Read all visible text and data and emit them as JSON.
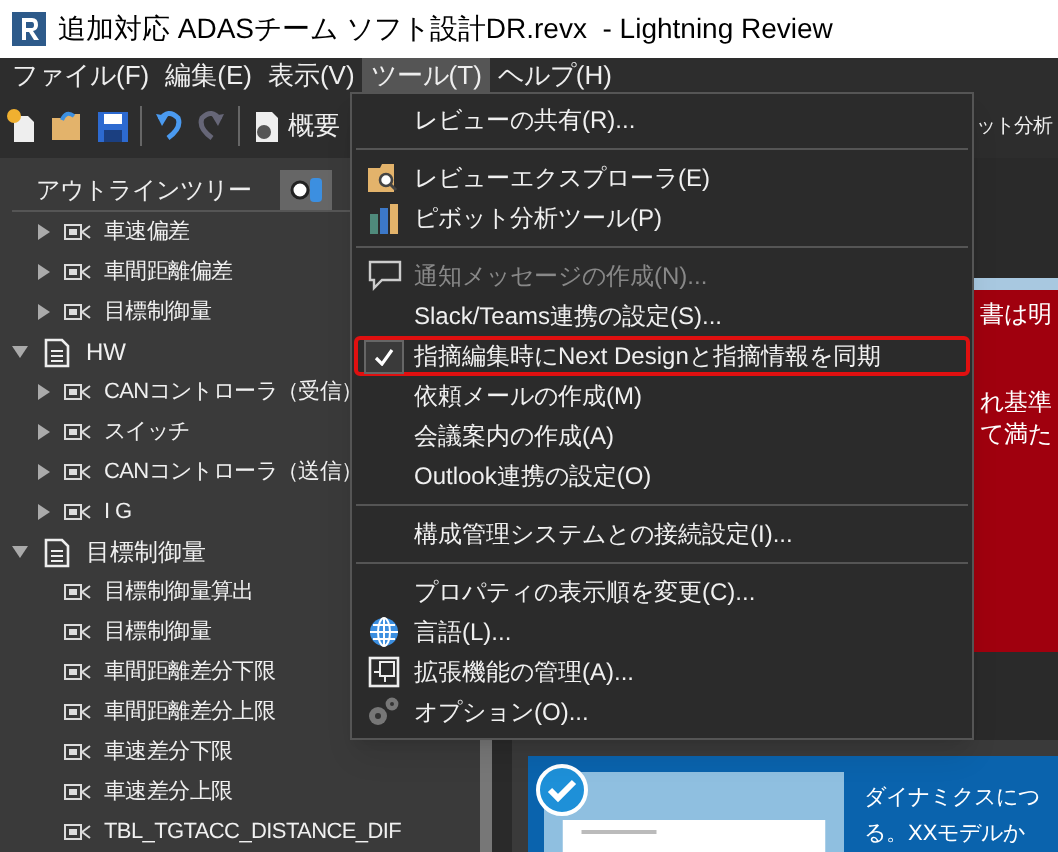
{
  "window": {
    "title": "追加対応 ADASチーム ソフト設計DR.revx  - Lightning Review"
  },
  "menu_bar": [
    {
      "label": "ファイル(F)",
      "selected": false
    },
    {
      "label": "編集(E)",
      "selected": false
    },
    {
      "label": "表示(V)",
      "selected": false
    },
    {
      "label": "ツール(T)",
      "selected": true
    },
    {
      "label": "ヘルプ(H)",
      "selected": false
    }
  ],
  "toolbar": {
    "overview": "概要",
    "right_label": "ット分析"
  },
  "outline": {
    "title": "アウトラインツリー",
    "partial_children": [
      {
        "label": "車速偏差",
        "expandable": true
      },
      {
        "label": "車間距離偏差",
        "expandable": true
      },
      {
        "label": "目標制御量",
        "expandable": true
      }
    ],
    "nodes": [
      {
        "label": "HW",
        "expanded": true,
        "children": [
          {
            "label": "CANコントローラ（受信）",
            "expandable": true
          },
          {
            "label": "スイッチ",
            "expandable": true
          },
          {
            "label": "CANコントローラ（送信）",
            "expandable": true
          },
          {
            "label": "I G",
            "expandable": true
          }
        ]
      },
      {
        "label": "目標制御量",
        "expanded": true,
        "children": [
          {
            "label": "目標制御量算出",
            "expandable": false
          },
          {
            "label": "目標制御量",
            "expandable": false
          },
          {
            "label": "車間距離差分下限",
            "expandable": false
          },
          {
            "label": "車間距離差分上限",
            "expandable": false
          },
          {
            "label": "車速差分下限",
            "expandable": false
          },
          {
            "label": "車速差分上限",
            "expandable": false
          },
          {
            "label": "TBL_TGTACC_DISTANCE_DIF",
            "expandable": false
          }
        ]
      }
    ]
  },
  "tools_menu": [
    {
      "kind": "plain",
      "label": "レビューの共有(R)...",
      "disabled": false,
      "checked": false,
      "highlighted": false
    },
    {
      "kind": "separator"
    },
    {
      "kind": "folder",
      "label": "レビューエクスプローラ(E)",
      "disabled": false,
      "checked": false,
      "highlighted": false
    },
    {
      "kind": "chart",
      "label": "ピボット分析ツール(P)",
      "disabled": false,
      "checked": false,
      "highlighted": false
    },
    {
      "kind": "separator"
    },
    {
      "kind": "comment",
      "label": "通知メッセージの作成(N)...",
      "disabled": true,
      "checked": false,
      "highlighted": false
    },
    {
      "kind": "plain",
      "label": "Slack/Teams連携の設定(S)...",
      "disabled": false,
      "checked": false,
      "highlighted": false
    },
    {
      "kind": "plain",
      "label": "指摘編集時にNext Designと指摘情報を同期",
      "disabled": false,
      "checked": true,
      "highlighted": true
    },
    {
      "kind": "plain",
      "label": "依頼メールの作成(M)",
      "disabled": false,
      "checked": false,
      "highlighted": false
    },
    {
      "kind": "plain",
      "label": "会議案内の作成(A)",
      "disabled": false,
      "checked": false,
      "highlighted": false
    },
    {
      "kind": "plain",
      "label": "Outlook連携の設定(O)",
      "disabled": false,
      "checked": false,
      "highlighted": false
    },
    {
      "kind": "separator"
    },
    {
      "kind": "plain",
      "label": "構成管理システムとの接続設定(I)...",
      "disabled": false,
      "checked": false,
      "highlighted": false
    },
    {
      "kind": "separator"
    },
    {
      "kind": "plain",
      "label": "プロパティの表示順を変更(C)...",
      "disabled": false,
      "checked": false,
      "highlighted": false
    },
    {
      "kind": "globe",
      "label": "言語(L)...",
      "disabled": false,
      "checked": false,
      "highlighted": false
    },
    {
      "kind": "extension",
      "label": "拡張機能の管理(A)...",
      "disabled": false,
      "checked": false,
      "highlighted": false
    },
    {
      "kind": "gear",
      "label": "オプション(O)...",
      "disabled": false,
      "checked": false,
      "highlighted": false
    }
  ],
  "alert_panel": {
    "lines": [
      "書は明",
      "れ基準",
      "て満た"
    ]
  },
  "card": {
    "lines": [
      "ダイナミクスにつ",
      "る。XXモデルか"
    ]
  }
}
